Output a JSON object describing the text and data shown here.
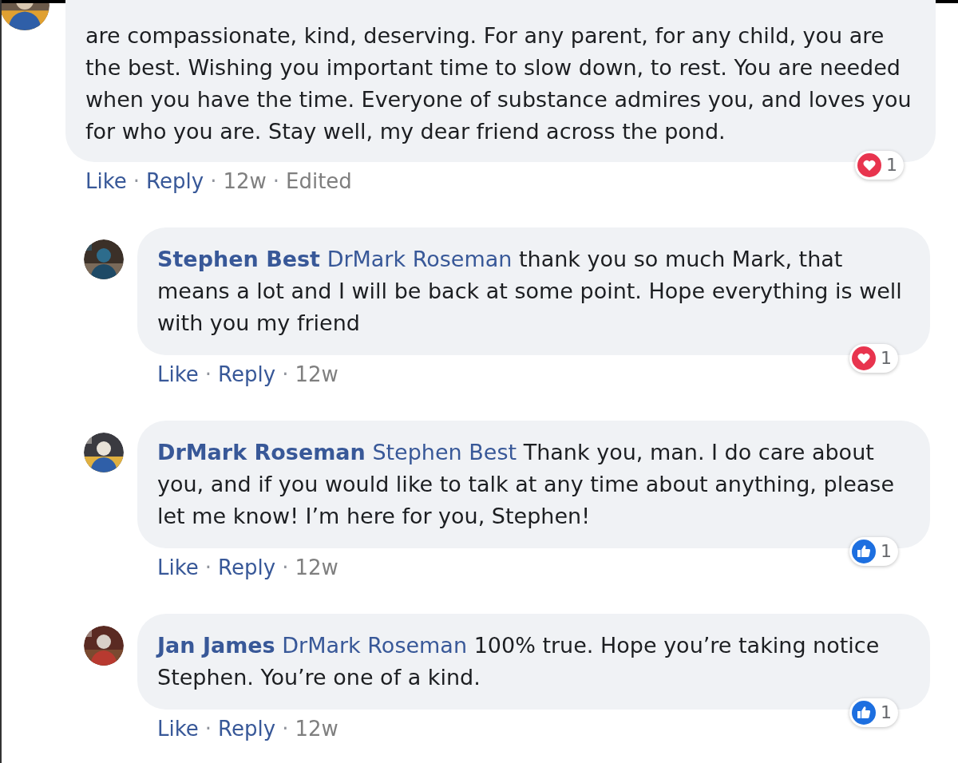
{
  "comments": [
    {
      "text": "are compassionate, kind, deserving. For any parent, for any child, you are the best. Wishing you important time to slow down, to rest. You are needed when you have the time. Everyone of substance admires you, and loves you for who you are. Stay well, my dear friend across the pond.",
      "reply": false,
      "avatar": {
        "kind": "picture"
      },
      "actions": [
        {
          "label": "Like",
          "kind": "link"
        },
        {
          "label": "Reply",
          "kind": "link"
        },
        {
          "label": "12w",
          "kind": "time"
        },
        {
          "label": "Edited",
          "kind": "meta"
        }
      ],
      "separator": "·",
      "reaction": {
        "kind": "love",
        "count": "1"
      }
    },
    {
      "author": "Stephen Best",
      "mention": "DrMark Roseman",
      "text": "thank you so much Mark, that means a lot and I will be back at some point. Hope everything is well with you my friend",
      "reply": true,
      "avatar": {
        "kind": "picture"
      },
      "actions": [
        {
          "label": "Like",
          "kind": "link"
        },
        {
          "label": "Reply",
          "kind": "link"
        },
        {
          "label": "12w",
          "kind": "time"
        }
      ],
      "separator": "·",
      "reaction": {
        "kind": "love",
        "count": "1"
      }
    },
    {
      "author": "DrMark Roseman",
      "mention": "Stephen Best",
      "text": "Thank you, man. I do care about you, and if you would like to talk at any time about anything, please let me know! I’m here for you, Stephen!",
      "reply": true,
      "avatar": {
        "kind": "picture"
      },
      "actions": [
        {
          "label": "Like",
          "kind": "link"
        },
        {
          "label": "Reply",
          "kind": "link"
        },
        {
          "label": "12w",
          "kind": "time"
        }
      ],
      "separator": "·",
      "reaction": {
        "kind": "like",
        "count": "1"
      }
    },
    {
      "author": "Jan James",
      "mention": "DrMark Roseman",
      "text": "100% true. Hope you’re taking notice Stephen. You’re one of a kind.",
      "reply": true,
      "avatar": {
        "kind": "picture"
      },
      "actions": [
        {
          "label": "Like",
          "kind": "link"
        },
        {
          "label": "Reply",
          "kind": "link"
        },
        {
          "label": "12w",
          "kind": "time"
        }
      ],
      "separator": "·",
      "reaction": {
        "kind": "like",
        "count": "1"
      }
    }
  ]
}
